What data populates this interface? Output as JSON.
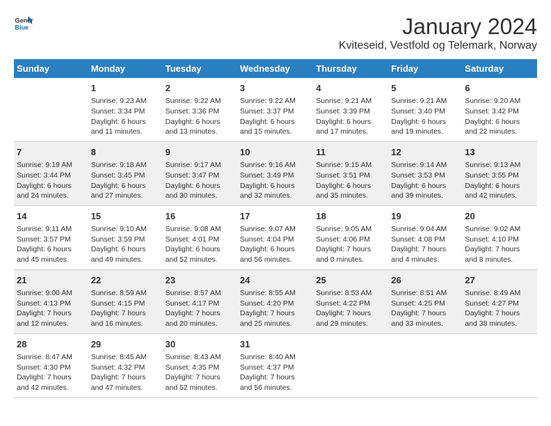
{
  "header": {
    "logo_general": "General",
    "logo_blue": "Blue",
    "main_title": "January 2024",
    "subtitle": "Kviteseid, Vestfold og Telemark, Norway"
  },
  "columns": [
    "Sunday",
    "Monday",
    "Tuesday",
    "Wednesday",
    "Thursday",
    "Friday",
    "Saturday"
  ],
  "weeks": [
    [
      {
        "day": "",
        "lines": []
      },
      {
        "day": "1",
        "lines": [
          "Sunrise: 9:23 AM",
          "Sunset: 3:34 PM",
          "Daylight: 6 hours",
          "and 11 minutes."
        ]
      },
      {
        "day": "2",
        "lines": [
          "Sunrise: 9:22 AM",
          "Sunset: 3:36 PM",
          "Daylight: 6 hours",
          "and 13 minutes."
        ]
      },
      {
        "day": "3",
        "lines": [
          "Sunrise: 9:22 AM",
          "Sunset: 3:37 PM",
          "Daylight: 6 hours",
          "and 15 minutes."
        ]
      },
      {
        "day": "4",
        "lines": [
          "Sunrise: 9:21 AM",
          "Sunset: 3:39 PM",
          "Daylight: 6 hours",
          "and 17 minutes."
        ]
      },
      {
        "day": "5",
        "lines": [
          "Sunrise: 9:21 AM",
          "Sunset: 3:40 PM",
          "Daylight: 6 hours",
          "and 19 minutes."
        ]
      },
      {
        "day": "6",
        "lines": [
          "Sunrise: 9:20 AM",
          "Sunset: 3:42 PM",
          "Daylight: 6 hours",
          "and 22 minutes."
        ]
      }
    ],
    [
      {
        "day": "7",
        "lines": [
          "Sunrise: 9:19 AM",
          "Sunset: 3:44 PM",
          "Daylight: 6 hours",
          "and 24 minutes."
        ]
      },
      {
        "day": "8",
        "lines": [
          "Sunrise: 9:18 AM",
          "Sunset: 3:45 PM",
          "Daylight: 6 hours",
          "and 27 minutes."
        ]
      },
      {
        "day": "9",
        "lines": [
          "Sunrise: 9:17 AM",
          "Sunset: 3:47 PM",
          "Daylight: 6 hours",
          "and 30 minutes."
        ]
      },
      {
        "day": "10",
        "lines": [
          "Sunrise: 9:16 AM",
          "Sunset: 3:49 PM",
          "Daylight: 6 hours",
          "and 32 minutes."
        ]
      },
      {
        "day": "11",
        "lines": [
          "Sunrise: 9:15 AM",
          "Sunset: 3:51 PM",
          "Daylight: 6 hours",
          "and 35 minutes."
        ]
      },
      {
        "day": "12",
        "lines": [
          "Sunrise: 9:14 AM",
          "Sunset: 3:53 PM",
          "Daylight: 6 hours",
          "and 39 minutes."
        ]
      },
      {
        "day": "13",
        "lines": [
          "Sunrise: 9:13 AM",
          "Sunset: 3:55 PM",
          "Daylight: 6 hours",
          "and 42 minutes."
        ]
      }
    ],
    [
      {
        "day": "14",
        "lines": [
          "Sunrise: 9:11 AM",
          "Sunset: 3:57 PM",
          "Daylight: 6 hours",
          "and 45 minutes."
        ]
      },
      {
        "day": "15",
        "lines": [
          "Sunrise: 9:10 AM",
          "Sunset: 3:59 PM",
          "Daylight: 6 hours",
          "and 49 minutes."
        ]
      },
      {
        "day": "16",
        "lines": [
          "Sunrise: 9:08 AM",
          "Sunset: 4:01 PM",
          "Daylight: 6 hours",
          "and 52 minutes."
        ]
      },
      {
        "day": "17",
        "lines": [
          "Sunrise: 9:07 AM",
          "Sunset: 4:04 PM",
          "Daylight: 6 hours",
          "and 56 minutes."
        ]
      },
      {
        "day": "18",
        "lines": [
          "Sunrise: 9:05 AM",
          "Sunset: 4:06 PM",
          "Daylight: 7 hours",
          "and 0 minutes."
        ]
      },
      {
        "day": "19",
        "lines": [
          "Sunrise: 9:04 AM",
          "Sunset: 4:08 PM",
          "Daylight: 7 hours",
          "and 4 minutes."
        ]
      },
      {
        "day": "20",
        "lines": [
          "Sunrise: 9:02 AM",
          "Sunset: 4:10 PM",
          "Daylight: 7 hours",
          "and 8 minutes."
        ]
      }
    ],
    [
      {
        "day": "21",
        "lines": [
          "Sunrise: 9:00 AM",
          "Sunset: 4:13 PM",
          "Daylight: 7 hours",
          "and 12 minutes."
        ]
      },
      {
        "day": "22",
        "lines": [
          "Sunrise: 8:59 AM",
          "Sunset: 4:15 PM",
          "Daylight: 7 hours",
          "and 16 minutes."
        ]
      },
      {
        "day": "23",
        "lines": [
          "Sunrise: 8:57 AM",
          "Sunset: 4:17 PM",
          "Daylight: 7 hours",
          "and 20 minutes."
        ]
      },
      {
        "day": "24",
        "lines": [
          "Sunrise: 8:55 AM",
          "Sunset: 4:20 PM",
          "Daylight: 7 hours",
          "and 25 minutes."
        ]
      },
      {
        "day": "25",
        "lines": [
          "Sunrise: 8:53 AM",
          "Sunset: 4:22 PM",
          "Daylight: 7 hours",
          "and 29 minutes."
        ]
      },
      {
        "day": "26",
        "lines": [
          "Sunrise: 8:51 AM",
          "Sunset: 4:25 PM",
          "Daylight: 7 hours",
          "and 33 minutes."
        ]
      },
      {
        "day": "27",
        "lines": [
          "Sunrise: 8:49 AM",
          "Sunset: 4:27 PM",
          "Daylight: 7 hours",
          "and 38 minutes."
        ]
      }
    ],
    [
      {
        "day": "28",
        "lines": [
          "Sunrise: 8:47 AM",
          "Sunset: 4:30 PM",
          "Daylight: 7 hours",
          "and 42 minutes."
        ]
      },
      {
        "day": "29",
        "lines": [
          "Sunrise: 8:45 AM",
          "Sunset: 4:32 PM",
          "Daylight: 7 hours",
          "and 47 minutes."
        ]
      },
      {
        "day": "30",
        "lines": [
          "Sunrise: 8:43 AM",
          "Sunset: 4:35 PM",
          "Daylight: 7 hours",
          "and 52 minutes."
        ]
      },
      {
        "day": "31",
        "lines": [
          "Sunrise: 8:40 AM",
          "Sunset: 4:37 PM",
          "Daylight: 7 hours",
          "and 56 minutes."
        ]
      },
      {
        "day": "",
        "lines": []
      },
      {
        "day": "",
        "lines": []
      },
      {
        "day": "",
        "lines": []
      }
    ]
  ]
}
